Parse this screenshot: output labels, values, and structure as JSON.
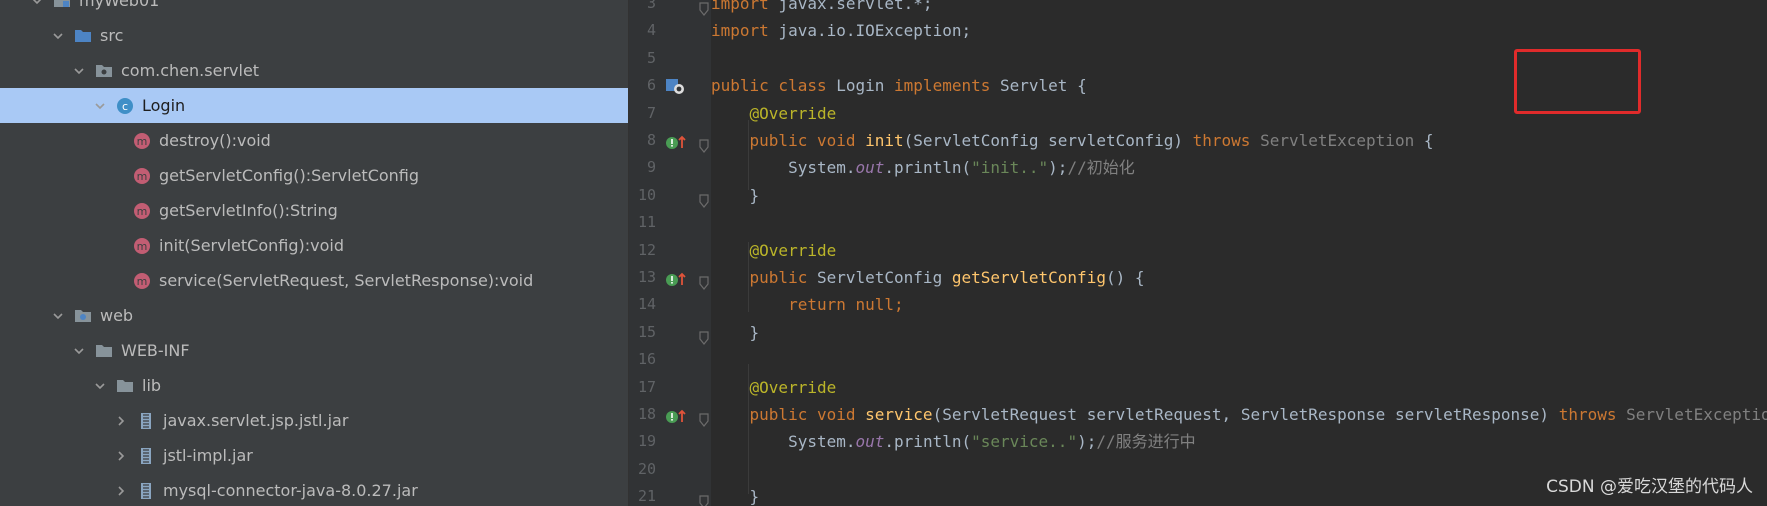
{
  "project_tree": {
    "items": [
      {
        "label": "myWeb01",
        "icon": "module-folder-icon",
        "expanded": true
      },
      {
        "label": "src",
        "icon": "source-folder-icon",
        "expanded": true
      },
      {
        "label": "com.chen.servlet",
        "icon": "package-icon",
        "expanded": true
      },
      {
        "label": "Login",
        "icon": "class-icon",
        "expanded": true,
        "selected": true
      },
      {
        "label": "destroy():void",
        "icon": "method-icon"
      },
      {
        "label": "getServletConfig():ServletConfig",
        "icon": "method-icon"
      },
      {
        "label": "getServletInfo():String",
        "icon": "method-icon"
      },
      {
        "label": "init(ServletConfig):void",
        "icon": "method-icon"
      },
      {
        "label": "service(ServletRequest, ServletResponse):void",
        "icon": "method-icon"
      },
      {
        "label": "web",
        "icon": "web-folder-icon",
        "expanded": true
      },
      {
        "label": "WEB-INF",
        "icon": "folder-icon",
        "expanded": true
      },
      {
        "label": "lib",
        "icon": "folder-icon",
        "expanded": true
      },
      {
        "label": "javax.servlet.jsp.jstl.jar",
        "icon": "jar-icon",
        "expanded": false
      },
      {
        "label": "jstl-impl.jar",
        "icon": "jar-icon",
        "expanded": false
      },
      {
        "label": "mysql-connector-java-8.0.27.jar",
        "icon": "jar-icon",
        "expanded": false
      }
    ]
  },
  "editor": {
    "lines": [
      {
        "n": "3",
        "parts": [
          [
            "kw",
            "import "
          ],
          [
            "",
            "javax.servlet.*;"
          ]
        ]
      },
      {
        "n": "4",
        "parts": [
          [
            "kw",
            "import "
          ],
          [
            "",
            "java.io.IOException;"
          ]
        ]
      },
      {
        "n": "5",
        "parts": []
      },
      {
        "n": "6",
        "parts": [
          [
            "kw",
            "public class "
          ],
          [
            "",
            "Login "
          ],
          [
            "kw",
            "implements "
          ],
          [
            "",
            "Servlet {"
          ]
        ],
        "gutter": "class-implements-icon"
      },
      {
        "n": "7",
        "parts": [
          [
            "",
            "    "
          ],
          [
            "ann",
            "@Override"
          ]
        ]
      },
      {
        "n": "8",
        "parts": [
          [
            "",
            "    "
          ],
          [
            "kw",
            "public void "
          ],
          [
            "fn",
            "init"
          ],
          [
            "",
            "(ServletConfig servletConfig) "
          ],
          [
            "kw",
            "throws "
          ],
          [
            "gray",
            "ServletException "
          ],
          [
            "",
            "{"
          ]
        ],
        "gutter": "implements-method-icon"
      },
      {
        "n": "9",
        "parts": [
          [
            "",
            "        System."
          ],
          [
            "fld",
            "out"
          ],
          [
            "",
            ".println("
          ],
          [
            "str",
            "\"init..\""
          ],
          [
            "",
            ");"
          ],
          [
            "cmt",
            "//初始化"
          ]
        ]
      },
      {
        "n": "10",
        "parts": [
          [
            "",
            "    }"
          ]
        ]
      },
      {
        "n": "11",
        "parts": []
      },
      {
        "n": "12",
        "parts": [
          [
            "",
            "    "
          ],
          [
            "ann",
            "@Override"
          ]
        ]
      },
      {
        "n": "13",
        "parts": [
          [
            "",
            "    "
          ],
          [
            "kw",
            "public "
          ],
          [
            "",
            "ServletConfig "
          ],
          [
            "fn",
            "getServletConfig"
          ],
          [
            "",
            "() {"
          ]
        ],
        "gutter": "implements-method-icon"
      },
      {
        "n": "14",
        "parts": [
          [
            "",
            "        "
          ],
          [
            "kw",
            "return null;"
          ]
        ]
      },
      {
        "n": "15",
        "parts": [
          [
            "",
            "    }"
          ]
        ]
      },
      {
        "n": "16",
        "parts": []
      },
      {
        "n": "17",
        "parts": [
          [
            "",
            "    "
          ],
          [
            "ann",
            "@Override"
          ]
        ]
      },
      {
        "n": "18",
        "parts": [
          [
            "",
            "    "
          ],
          [
            "kw",
            "public void "
          ],
          [
            "fn",
            "service"
          ],
          [
            "",
            "(ServletRequest servletRequest, ServletResponse servletResponse) "
          ],
          [
            "kw",
            "throws "
          ],
          [
            "gray",
            "ServletException"
          ]
        ],
        "gutter": "implements-method-icon"
      },
      {
        "n": "19",
        "parts": [
          [
            "",
            "        System."
          ],
          [
            "fld",
            "out"
          ],
          [
            "",
            ".println("
          ],
          [
            "str",
            "\"service..\""
          ],
          [
            "",
            ");"
          ],
          [
            "cmt",
            "//服务进行中"
          ]
        ]
      },
      {
        "n": "20",
        "parts": []
      },
      {
        "n": "21",
        "parts": [
          [
            "",
            "    }"
          ]
        ]
      }
    ]
  },
  "watermark": "CSDN @爱吃汉堡的代码人",
  "colors": {
    "keyword": "#cc7832",
    "annotation": "#bbb529",
    "method": "#ffc66d",
    "string": "#6a8759",
    "comment": "#808080",
    "highlight_box": "#e02b2b"
  }
}
